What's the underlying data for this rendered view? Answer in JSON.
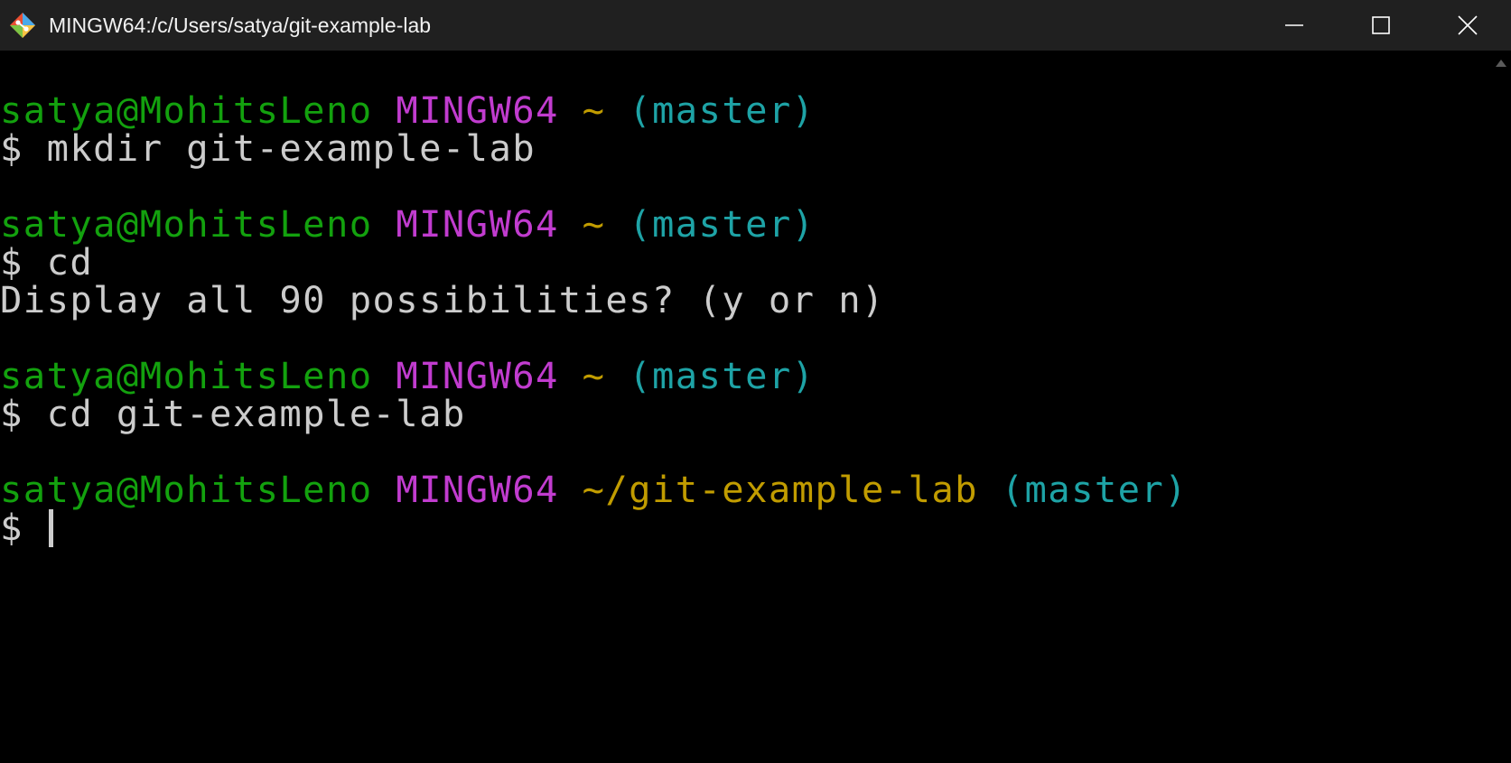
{
  "window": {
    "title": "MINGW64:/c/Users/satya/git-example-lab",
    "app_icon": "git-bash-icon"
  },
  "controls": {
    "minimize_icon": "minimize-icon",
    "maximize_icon": "maximize-icon",
    "close_icon": "close-icon"
  },
  "colors": {
    "user_host": "#13a10e",
    "system": "#c13ccf",
    "path": "#c19c00",
    "branch": "#1ea3a6",
    "text": "#cccccc",
    "titlebar": "#202020"
  },
  "terminal": {
    "prompt1": {
      "user_host": "satya@MohitsLeno",
      "system": "MINGW64",
      "path": "~",
      "branch": "(master)"
    },
    "cmd1": "$ mkdir git-example-lab",
    "prompt2": {
      "user_host": "satya@MohitsLeno",
      "system": "MINGW64",
      "path": "~",
      "branch": "(master)"
    },
    "cmd2": "$ cd",
    "output2": "Display all 90 possibilities? (y or n)",
    "prompt3": {
      "user_host": "satya@MohitsLeno",
      "system": "MINGW64",
      "path": "~",
      "branch": "(master)"
    },
    "cmd3": "$ cd git-example-lab",
    "prompt4": {
      "user_host": "satya@MohitsLeno",
      "system": "MINGW64",
      "path": "~/git-example-lab",
      "branch": "(master)"
    },
    "cmd4": "$ "
  }
}
